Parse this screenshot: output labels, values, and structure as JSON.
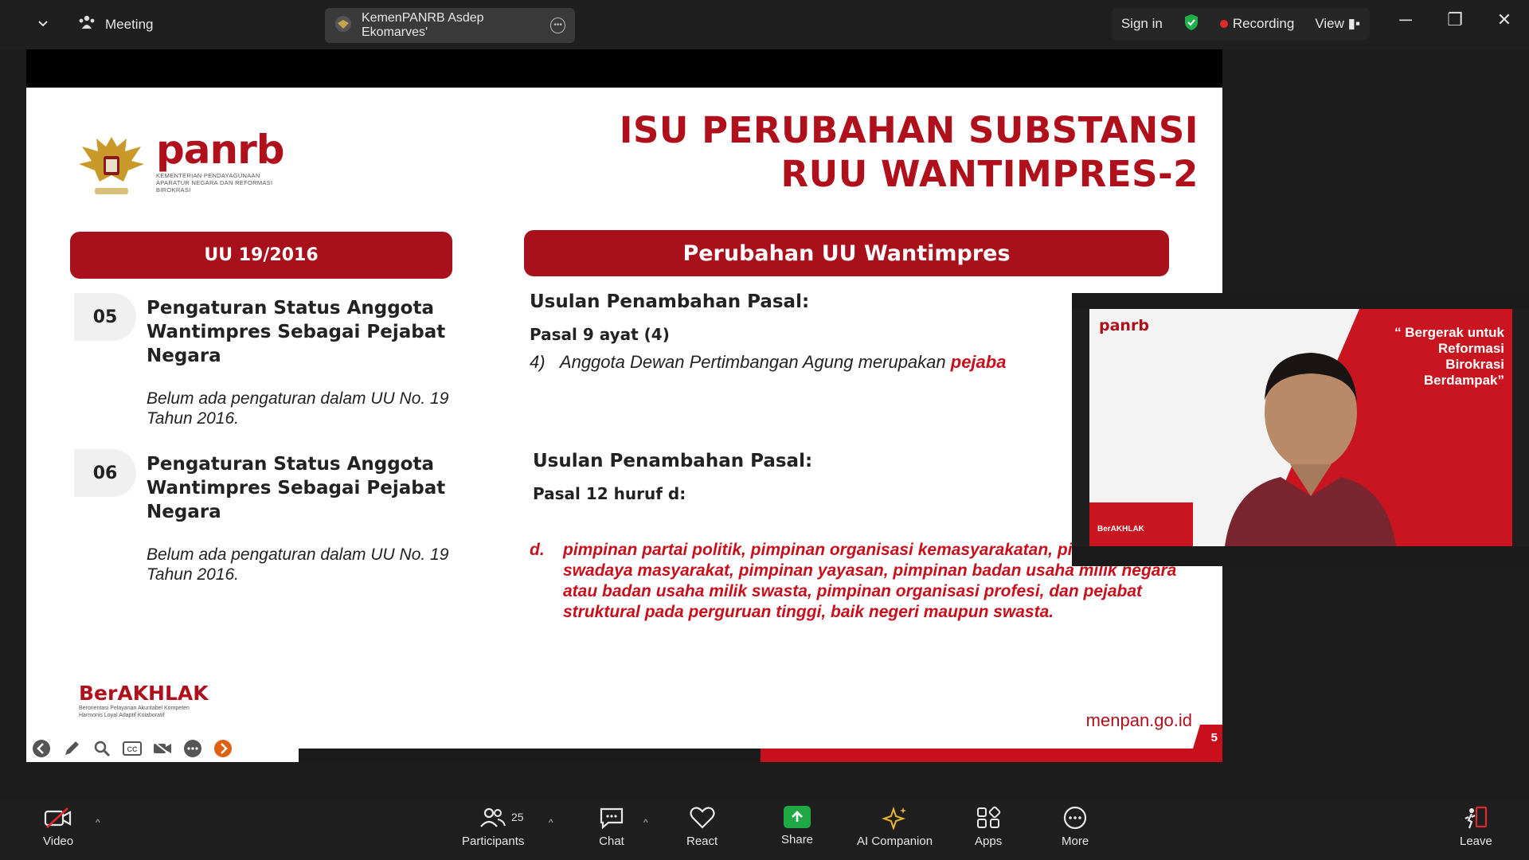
{
  "topbar": {
    "meeting_label": "Meeting",
    "tab_title": "KemenPANRB Asdep Ekomarves'",
    "sign_in": "Sign in",
    "recording": "Recording",
    "view": "View"
  },
  "slide": {
    "brand_name": "panrb",
    "brand_sub": "KEMENTERIAN PENDAYAGUNAAN APARATUR NEGARA DAN REFORMASI BIROKRASI",
    "title_line1": "ISU PERUBAHAN SUBSTANSI",
    "title_line2": "RUU WANTIMPRES-2",
    "left_header": "UU 19/2016",
    "right_header": "Perubahan UU Wantimpres",
    "items": [
      {
        "num": "05",
        "title": "Pengaturan Status Anggota Wantimpres Sebagai Pejabat Negara",
        "note": "Belum ada pengaturan dalam UU No. 19 Tahun 2016."
      },
      {
        "num": "06",
        "title": "Pengaturan Status Anggota Wantimpres Sebagai Pejabat Negara",
        "note": "Belum ada pengaturan dalam UU No. 19 Tahun 2016."
      }
    ],
    "usulan1": "Usulan Penambahan Pasal:",
    "pasal1": "Pasal 9 ayat (4)",
    "ayat_num": "4)",
    "ayat_text": "Anggota Dewan Pertimbangan Agung merupakan ",
    "ayat_highlight": "pejaba",
    "usulan2": "Usulan Penambahan Pasal:",
    "pasal2": "Pasal 12 huruf d:",
    "huruf_letter": "d.",
    "huruf_text": "pimpinan partai politik, pimpinan organisasi kemasyarakatan, pimpinan lembaga swadaya masyarakat, pimpinan yayasan, pimpinan badan usaha milik negara atau badan usaha milik swasta, pimpinan organisasi profesi, dan pejabat struktural pada perguruan tinggi, baik negeri maupun swasta.",
    "berakhlak": "BerAKHLAK",
    "berakhlak_tag": "Berorientasi Pelayanan Akuntabel Kompeten Harmonis Loyal Adaptif Kolaboratif",
    "site": "menpan.go.id",
    "page_num": "5"
  },
  "selfview": {
    "brand": "panrb",
    "quote_line1": "“ Bergerak untuk",
    "quote_line2": "Reformasi",
    "quote_line3": "Birokrasi",
    "quote_line4": "Berdampak”",
    "berakhlak": "BerAKHLAK"
  },
  "toolbar": {
    "video": "Video",
    "participants": "Participants",
    "participants_count": "25",
    "chat": "Chat",
    "react": "React",
    "share": "Share",
    "ai_companion": "AI Companion",
    "apps": "Apps",
    "more": "More",
    "leave": "Leave"
  },
  "colors": {
    "brand_red": "#b0101c",
    "share_green": "#1fa844",
    "toolbar_bg": "#1f1f1f"
  }
}
